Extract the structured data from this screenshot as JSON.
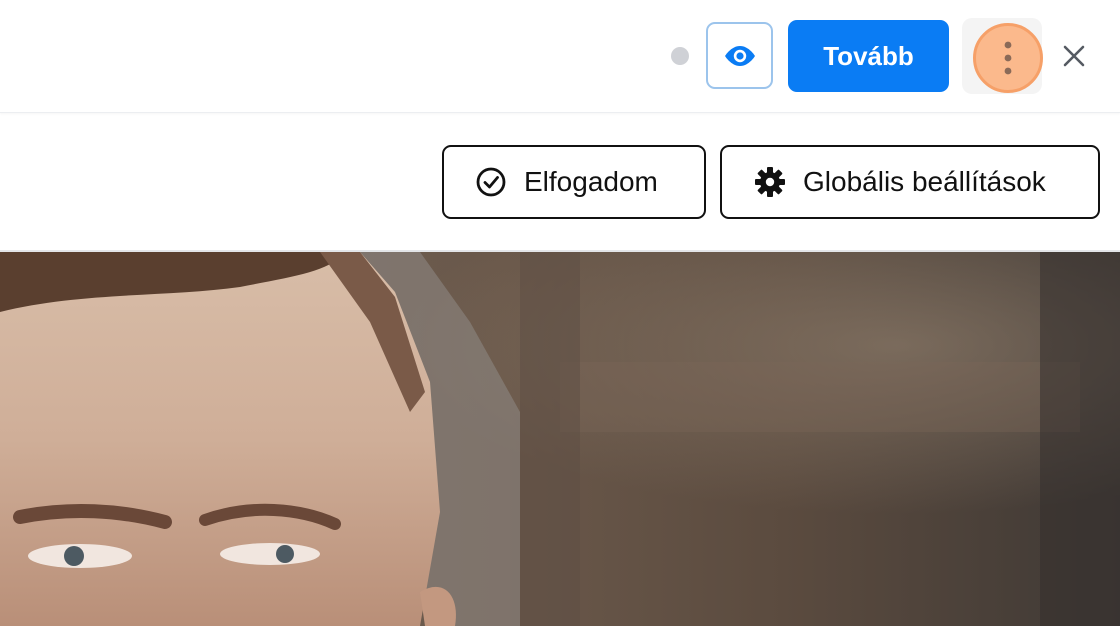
{
  "toolbar": {
    "status_dot": "status-indicator",
    "preview_icon": "eye-icon",
    "next_label": "Tovább",
    "more_icon": "more-vertical-icon",
    "close_icon": "close-icon"
  },
  "consent": {
    "accept_label": "Elfogadom",
    "accept_icon": "check-circle-icon",
    "global_settings_label": "Globális beállítások",
    "global_settings_icon": "gear-icon"
  },
  "hero": {
    "image_subject": "man-portrait-photo"
  },
  "colors": {
    "primary": "#0a7cf4",
    "preview_border": "#9cc4ec",
    "highlight_fill": "#fbb98c",
    "highlight_border": "#f6a068",
    "text": "#111111"
  }
}
